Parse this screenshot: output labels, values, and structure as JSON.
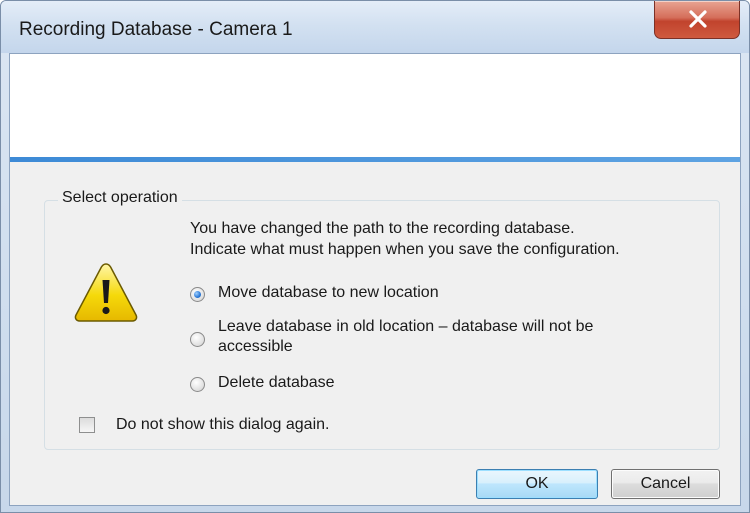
{
  "window": {
    "title": "Recording Database - Camera 1",
    "close_glyph": "x"
  },
  "group": {
    "legend": "Select operation",
    "message_line1": "You have changed the path to the recording database.",
    "message_line2": "Indicate what must happen when you save the configuration.",
    "icon": "warning-icon"
  },
  "options": [
    {
      "line1": "Move database to new location",
      "line2": "",
      "selected": true
    },
    {
      "line1": "Leave database in old location – database will not be",
      "line2": "accessible",
      "selected": false
    },
    {
      "line1": "Delete database",
      "line2": "",
      "selected": false
    }
  ],
  "checkbox": {
    "label": "Do not show this dialog again.",
    "checked": false
  },
  "buttons": {
    "ok": "OK",
    "cancel": "Cancel"
  },
  "colors": {
    "accent_line": "#3d8ad6",
    "close_button": "#c1432d",
    "warning_fill": "#f5d90a"
  }
}
